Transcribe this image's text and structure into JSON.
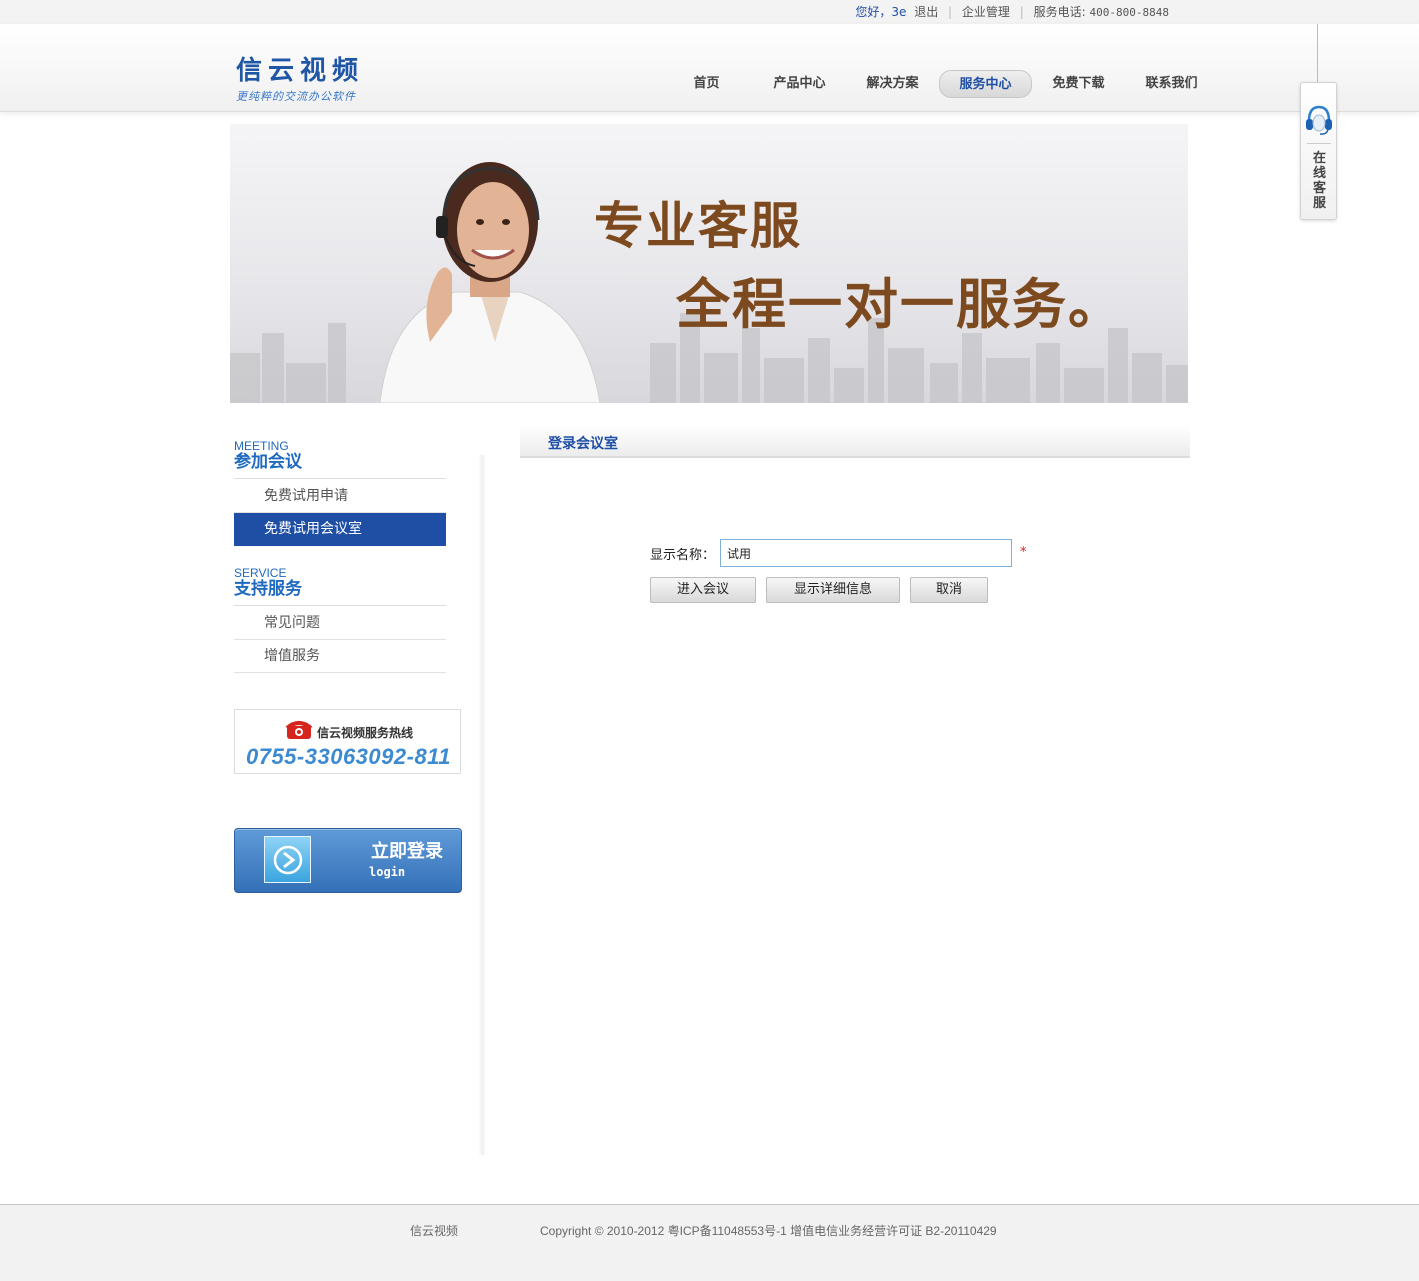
{
  "topbar": {
    "greeting": "您好，3e",
    "logout": "退出",
    "enterprise": "企业管理",
    "phone_label": "服务电话:",
    "phone": "400-800-8848"
  },
  "logo": {
    "title": "信云视频",
    "subtitle": "更纯粹的交流办公软件"
  },
  "nav": {
    "items": [
      "首页",
      "产品中心",
      "解决方案",
      "服务中心",
      "免费下载",
      "联系我们"
    ],
    "active": "服务中心"
  },
  "float_service": {
    "icon": "headset-icon",
    "label": "在\n线\n客\n服"
  },
  "banner": {
    "line1": "专业客服",
    "line2": "全程一对一服务。"
  },
  "sidebar": {
    "group1": {
      "en": "MEETING",
      "cn": "参加会议",
      "items": [
        "免费试用申请",
        "免费试用会议室"
      ],
      "active_index": 1
    },
    "group2": {
      "en": "SERVICE",
      "cn": "支持服务",
      "items": [
        "常见问题",
        "增值服务"
      ]
    },
    "hotline": {
      "label": "信云视频服务热线",
      "number": "0755-33063092-811",
      "icon": "phone-icon"
    },
    "login": {
      "title": "立即登录",
      "sub": "login",
      "icon": "arrow-right-icon"
    }
  },
  "content": {
    "title": "登录会议室",
    "form": {
      "label": "显示名称：",
      "value": "试用",
      "required_mark": "*",
      "buttons": [
        "进入会议",
        "显示详细信息",
        "取消"
      ]
    }
  },
  "footer": {
    "brand": "信云视频",
    "copyright": "Copyright ©  2010-2012  粤ICP备11048553号-1  增值电信业务经营许可证 B2-20110429"
  },
  "colors": {
    "brand_blue": "#1f4fa5",
    "accent_blue": "#1f6abf",
    "banner_text": "#7c4a1e",
    "required": "#e02020"
  }
}
